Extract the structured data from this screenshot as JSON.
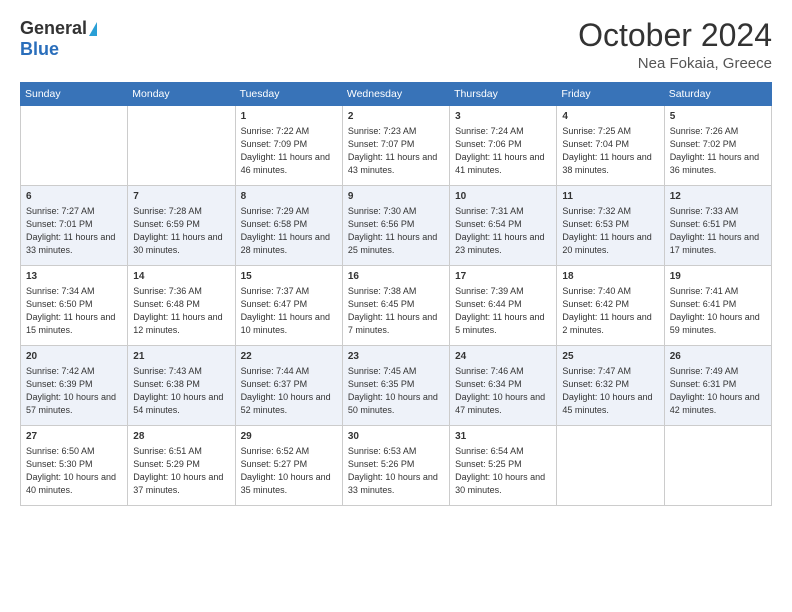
{
  "header": {
    "logo_general": "General",
    "logo_blue": "Blue",
    "month_title": "October 2024",
    "location": "Nea Fokaia, Greece"
  },
  "weekdays": [
    "Sunday",
    "Monday",
    "Tuesday",
    "Wednesday",
    "Thursday",
    "Friday",
    "Saturday"
  ],
  "weeks": [
    [
      {
        "day": "",
        "info": ""
      },
      {
        "day": "",
        "info": ""
      },
      {
        "day": "1",
        "info": "Sunrise: 7:22 AM\nSunset: 7:09 PM\nDaylight: 11 hours and 46 minutes."
      },
      {
        "day": "2",
        "info": "Sunrise: 7:23 AM\nSunset: 7:07 PM\nDaylight: 11 hours and 43 minutes."
      },
      {
        "day": "3",
        "info": "Sunrise: 7:24 AM\nSunset: 7:06 PM\nDaylight: 11 hours and 41 minutes."
      },
      {
        "day": "4",
        "info": "Sunrise: 7:25 AM\nSunset: 7:04 PM\nDaylight: 11 hours and 38 minutes."
      },
      {
        "day": "5",
        "info": "Sunrise: 7:26 AM\nSunset: 7:02 PM\nDaylight: 11 hours and 36 minutes."
      }
    ],
    [
      {
        "day": "6",
        "info": "Sunrise: 7:27 AM\nSunset: 7:01 PM\nDaylight: 11 hours and 33 minutes."
      },
      {
        "day": "7",
        "info": "Sunrise: 7:28 AM\nSunset: 6:59 PM\nDaylight: 11 hours and 30 minutes."
      },
      {
        "day": "8",
        "info": "Sunrise: 7:29 AM\nSunset: 6:58 PM\nDaylight: 11 hours and 28 minutes."
      },
      {
        "day": "9",
        "info": "Sunrise: 7:30 AM\nSunset: 6:56 PM\nDaylight: 11 hours and 25 minutes."
      },
      {
        "day": "10",
        "info": "Sunrise: 7:31 AM\nSunset: 6:54 PM\nDaylight: 11 hours and 23 minutes."
      },
      {
        "day": "11",
        "info": "Sunrise: 7:32 AM\nSunset: 6:53 PM\nDaylight: 11 hours and 20 minutes."
      },
      {
        "day": "12",
        "info": "Sunrise: 7:33 AM\nSunset: 6:51 PM\nDaylight: 11 hours and 17 minutes."
      }
    ],
    [
      {
        "day": "13",
        "info": "Sunrise: 7:34 AM\nSunset: 6:50 PM\nDaylight: 11 hours and 15 minutes."
      },
      {
        "day": "14",
        "info": "Sunrise: 7:36 AM\nSunset: 6:48 PM\nDaylight: 11 hours and 12 minutes."
      },
      {
        "day": "15",
        "info": "Sunrise: 7:37 AM\nSunset: 6:47 PM\nDaylight: 11 hours and 10 minutes."
      },
      {
        "day": "16",
        "info": "Sunrise: 7:38 AM\nSunset: 6:45 PM\nDaylight: 11 hours and 7 minutes."
      },
      {
        "day": "17",
        "info": "Sunrise: 7:39 AM\nSunset: 6:44 PM\nDaylight: 11 hours and 5 minutes."
      },
      {
        "day": "18",
        "info": "Sunrise: 7:40 AM\nSunset: 6:42 PM\nDaylight: 11 hours and 2 minutes."
      },
      {
        "day": "19",
        "info": "Sunrise: 7:41 AM\nSunset: 6:41 PM\nDaylight: 10 hours and 59 minutes."
      }
    ],
    [
      {
        "day": "20",
        "info": "Sunrise: 7:42 AM\nSunset: 6:39 PM\nDaylight: 10 hours and 57 minutes."
      },
      {
        "day": "21",
        "info": "Sunrise: 7:43 AM\nSunset: 6:38 PM\nDaylight: 10 hours and 54 minutes."
      },
      {
        "day": "22",
        "info": "Sunrise: 7:44 AM\nSunset: 6:37 PM\nDaylight: 10 hours and 52 minutes."
      },
      {
        "day": "23",
        "info": "Sunrise: 7:45 AM\nSunset: 6:35 PM\nDaylight: 10 hours and 50 minutes."
      },
      {
        "day": "24",
        "info": "Sunrise: 7:46 AM\nSunset: 6:34 PM\nDaylight: 10 hours and 47 minutes."
      },
      {
        "day": "25",
        "info": "Sunrise: 7:47 AM\nSunset: 6:32 PM\nDaylight: 10 hours and 45 minutes."
      },
      {
        "day": "26",
        "info": "Sunrise: 7:49 AM\nSunset: 6:31 PM\nDaylight: 10 hours and 42 minutes."
      }
    ],
    [
      {
        "day": "27",
        "info": "Sunrise: 6:50 AM\nSunset: 5:30 PM\nDaylight: 10 hours and 40 minutes."
      },
      {
        "day": "28",
        "info": "Sunrise: 6:51 AM\nSunset: 5:29 PM\nDaylight: 10 hours and 37 minutes."
      },
      {
        "day": "29",
        "info": "Sunrise: 6:52 AM\nSunset: 5:27 PM\nDaylight: 10 hours and 35 minutes."
      },
      {
        "day": "30",
        "info": "Sunrise: 6:53 AM\nSunset: 5:26 PM\nDaylight: 10 hours and 33 minutes."
      },
      {
        "day": "31",
        "info": "Sunrise: 6:54 AM\nSunset: 5:25 PM\nDaylight: 10 hours and 30 minutes."
      },
      {
        "day": "",
        "info": ""
      },
      {
        "day": "",
        "info": ""
      }
    ]
  ]
}
